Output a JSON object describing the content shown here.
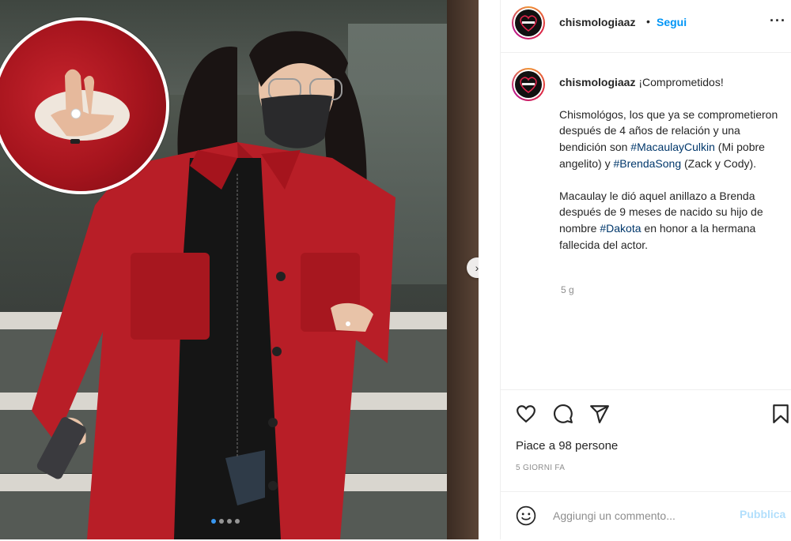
{
  "post": {
    "username": "chismologiaaz",
    "header_dot": "•",
    "follow_label": "Segui",
    "more_label": "···",
    "avatar_icon": "heart-logo-icon",
    "caption": {
      "title": "¡Comprometidos!",
      "para1_a": "Chismológos, los que ya se comprometieron después de 4 años de relación y una bendición son ",
      "hashtag1": "#MacaulayCulkin",
      "para1_b": " (Mi pobre angelito) y ",
      "hashtag2": "#BrendaSong",
      "para1_c": " (Zack y Cody).",
      "para2_a": "Macaulay le dió aquel anillazo a Brenda después de 9 meses de nacido su hijo de nombre ",
      "hashtag3": "#Dakota",
      "para2_b": " en honor a la hermana fallecida del actor."
    },
    "time_ago": "5 g",
    "likes": "Piace a 98 persone",
    "date": "5 GIORNI FA",
    "comment_placeholder": "Aggiungi un commento...",
    "publish_label": "Pubblica",
    "carousel": {
      "total": 4,
      "active": 1
    },
    "colors": {
      "link": "#0095f6",
      "hashtag": "#00376b",
      "publish_disabled": "#b2dffc",
      "jacket": "#b81e27"
    }
  }
}
